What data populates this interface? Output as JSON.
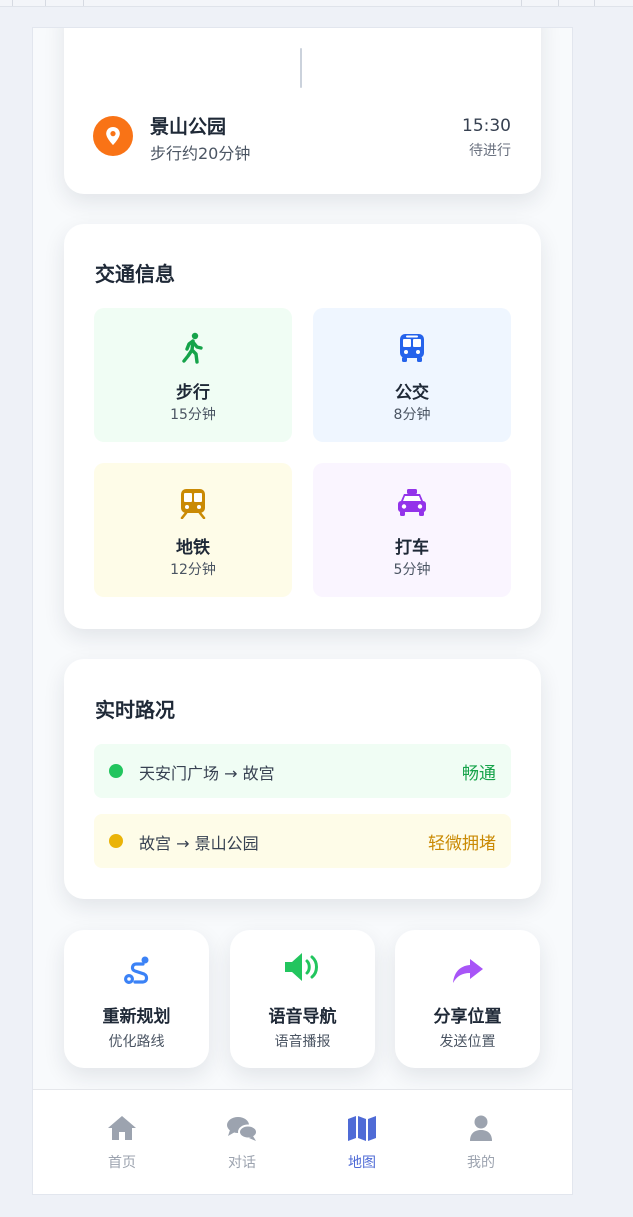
{
  "schedule": {
    "stop_name": "景山公园",
    "stop_sub": "步行约20分钟",
    "stop_time": "15:30",
    "stop_status": "待进行",
    "pin_icon": "map-pin-icon",
    "pin_color": "#f97316"
  },
  "traffic": {
    "title": "交通信息",
    "modes": [
      {
        "label": "步行",
        "value": "15分钟",
        "icon": "walk-icon",
        "color": "#16a34a",
        "bg": "#f0fdf4"
      },
      {
        "label": "公交",
        "value": "8分钟",
        "icon": "bus-icon",
        "color": "#2563eb",
        "bg": "#eff6ff"
      },
      {
        "label": "地铁",
        "value": "12分钟",
        "icon": "subway-icon",
        "color": "#ca8a04",
        "bg": "#fefce8"
      },
      {
        "label": "打车",
        "value": "5分钟",
        "icon": "taxi-icon",
        "color": "#9333ea",
        "bg": "#faf5ff"
      }
    ]
  },
  "realtime": {
    "title": "实时路况",
    "roads": [
      {
        "segment": "天安门广场 → 故宫",
        "status": "畅通",
        "dot_color": "#22c55e",
        "status_color": "#16a34a",
        "bg": "#f0fdf4"
      },
      {
        "segment": "故宫 → 景山公园",
        "status": "轻微拥堵",
        "dot_color": "#eab308",
        "status_color": "#ca8a04",
        "bg": "#fefce8"
      }
    ]
  },
  "actions": [
    {
      "label": "重新规划",
      "sub": "优化路线",
      "icon": "route-icon",
      "color": "#3b82f6"
    },
    {
      "label": "语音导航",
      "sub": "语音播报",
      "icon": "volume-icon",
      "color": "#22c55e"
    },
    {
      "label": "分享位置",
      "sub": "发送位置",
      "icon": "share-icon",
      "color": "#a855f7"
    }
  ],
  "nav": {
    "items": [
      {
        "label": "首页",
        "icon": "home-icon"
      },
      {
        "label": "对话",
        "icon": "chat-icon"
      },
      {
        "label": "地图",
        "icon": "map-icon",
        "active": true
      },
      {
        "label": "我的",
        "icon": "user-icon"
      }
    ],
    "active_color": "#4f6bd6",
    "inactive_color": "#9ca3af"
  }
}
